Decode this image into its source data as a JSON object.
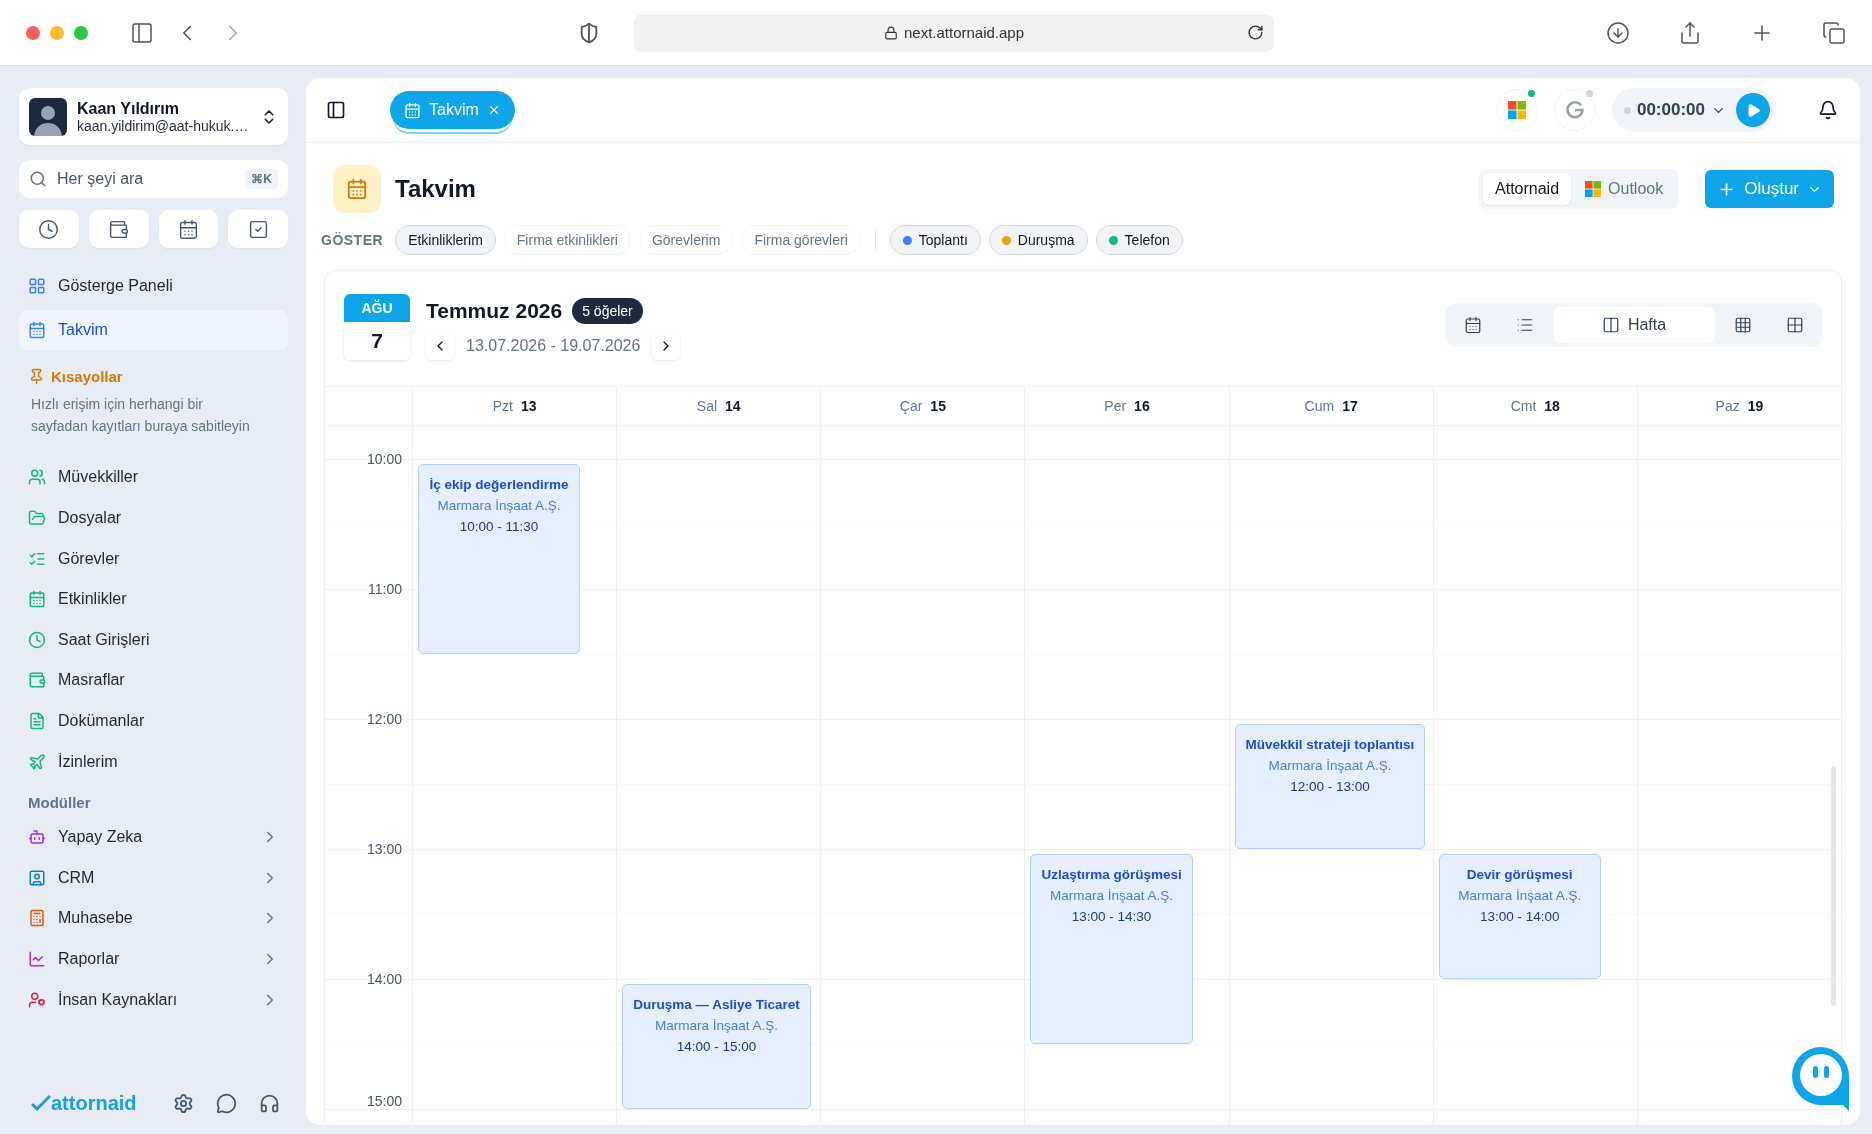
{
  "browser": {
    "url": "next.attornaid.app"
  },
  "user": {
    "name": "Kaan Yıldırım",
    "email": "kaan.yildirim@aat-hukuk.…"
  },
  "search": {
    "placeholder": "Her şeyi ara",
    "shortcut": "⌘K"
  },
  "nav": [
    {
      "label": "Gösterge Paneli",
      "selected": false
    },
    {
      "label": "Takvim",
      "selected": true
    }
  ],
  "shortcuts": {
    "title": "Kısayollar",
    "hint": "Hızlı erişim için herhangi bir sayfadan kayıtları buraya sabitleyin",
    "items": [
      "Müvekkiller",
      "Dosyalar",
      "Görevler",
      "Etkinlikler",
      "Saat Girişleri",
      "Masraflar",
      "Dokümanlar",
      "İzinlerim"
    ]
  },
  "modules": {
    "title": "Modüller",
    "items": [
      "Yapay Zeka",
      "CRM",
      "Muhasebe",
      "Raporlar",
      "İnsan Kaynakları"
    ]
  },
  "footer": {
    "logo": "attornaid"
  },
  "tabs": [
    {
      "label": "Takvim",
      "selected": true
    }
  ],
  "integrations": [
    {
      "kind": "microsoft",
      "connected": true
    },
    {
      "kind": "google",
      "connected": false
    }
  ],
  "timer": {
    "value": "00:00:00"
  },
  "page": {
    "title": "Takvim",
    "create": "Oluştur",
    "sources": [
      {
        "label": "Attornaid",
        "selected": true
      },
      {
        "label": "Outlook",
        "selected": false
      }
    ]
  },
  "filters": {
    "label": "GÖSTER",
    "scopes": [
      {
        "label": "Etkinliklerim",
        "selected": true
      },
      {
        "label": "Firma etkinlikleri",
        "selected": false
      },
      {
        "label": "Görevlerim",
        "selected": false
      },
      {
        "label": "Firma görevleri",
        "selected": false
      }
    ],
    "types": [
      {
        "label": "Toplantı",
        "color": "#3b82f6"
      },
      {
        "label": "Duruşma",
        "color": "#f59e0b"
      },
      {
        "label": "Telefon",
        "color": "#10b981"
      }
    ]
  },
  "calendar": {
    "badge_month": "AĞU",
    "badge_day": "7",
    "title": "Temmuz 2026",
    "count": "5 öğeler",
    "range": "13.07.2026 - 19.07.2026",
    "views": [
      {
        "kind": "month",
        "selected": false
      },
      {
        "kind": "list",
        "selected": false
      },
      {
        "kind": "week",
        "label": "Hafta",
        "selected": true
      },
      {
        "kind": "grid",
        "selected": false
      },
      {
        "kind": "quad",
        "selected": false
      }
    ],
    "hours": [
      "10:00",
      "11:00",
      "12:00",
      "13:00",
      "14:00",
      "15:00"
    ],
    "days": [
      {
        "name": "Pzt",
        "date": "13",
        "events": [
          {
            "title": "İç ekip değerlendirme",
            "client": "Marmara İnşaat A.Ş.",
            "time": "10:00 - 11:30"
          }
        ]
      },
      {
        "name": "Sal",
        "date": "14",
        "events": [
          {
            "title": "Duruşma — Asliye Ticaret",
            "client": "Marmara İnşaat A.Ş.",
            "time": "14:00 - 15:00"
          }
        ]
      },
      {
        "name": "Çar",
        "date": "15"
      },
      {
        "name": "Per",
        "date": "16",
        "events": [
          {
            "title": "Uzlaştırma görüşmesi",
            "client": "Marmara İnşaat A.Ş.",
            "time": "13:00 - 14:30"
          }
        ]
      },
      {
        "name": "Cum",
        "date": "17",
        "events": [
          {
            "title": "Müvekkil strateji toplantısı",
            "client": "Marmara İnşaat A.Ş.",
            "time": "12:00 - 13:00"
          }
        ]
      },
      {
        "name": "Cmt",
        "date": "18",
        "events": [
          {
            "title": "Devir görüşmesi",
            "client": "Marmara İnşaat A.Ş.",
            "time": "13:00 - 14:00"
          }
        ]
      },
      {
        "name": "Paz",
        "date": "19"
      }
    ]
  }
}
